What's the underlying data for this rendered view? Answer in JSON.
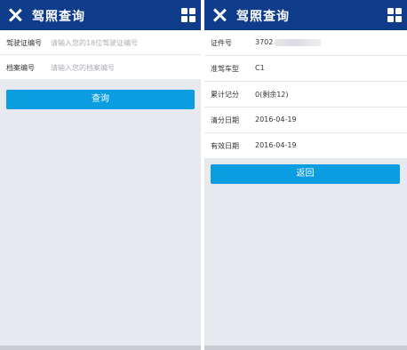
{
  "left": {
    "header": {
      "title": "驾照查询",
      "close_icon": "close-icon",
      "menu_icon": "grid-icon"
    },
    "form": {
      "fields": [
        {
          "label": "驾驶证编号",
          "placeholder": "请输入您的18位驾驶证编号"
        },
        {
          "label": "档案编号",
          "placeholder": "请输入您的档案编号"
        }
      ]
    },
    "query_button": "查询"
  },
  "right": {
    "header": {
      "title": "驾照查询",
      "close_icon": "close-icon",
      "menu_icon": "grid-icon"
    },
    "info": {
      "rows": [
        {
          "label": "证件号",
          "value": "3702"
        },
        {
          "label": "准驾车型",
          "value": "C1"
        },
        {
          "label": "累计记分",
          "value": "0(剩余12)"
        },
        {
          "label": "清分日期",
          "value": "2016-04-19"
        },
        {
          "label": "有效日期",
          "value": "2016-04-19"
        }
      ]
    },
    "back_button": "返回"
  },
  "colors": {
    "header": "#0f3d8c",
    "button": "#0a9de1",
    "background": "#e6e9ee"
  }
}
